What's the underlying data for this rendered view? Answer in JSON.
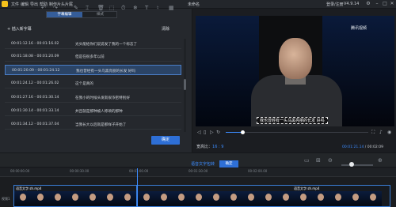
{
  "titlebar": {
    "menus": [
      "文件",
      "编辑",
      "导出",
      "帮助",
      "制作片头片尾"
    ],
    "document_title": "未命名",
    "login": "登录/注册",
    "version": "V4.9.14"
  },
  "subtitle_panel": {
    "tabs": [
      "字幕编辑",
      "样式"
    ],
    "add_button": "+ 插入新字幕",
    "clear_button": "清除",
    "rows": [
      {
        "time": "00:01:12.16 - 00:01:16.02",
        "text": "光头能给你们说说发了我的一个标志了"
      },
      {
        "time": "00:01:18.08 - 00:01:20.09",
        "text": "但是在很多年以前"
      },
      {
        "time": "00:01:20.09 - 00:01:24.12",
        "text": "我也曾经有一头乌黑亮丽的长发 好吗",
        "selected": true
      },
      {
        "time": "00:01:24.12 - 00:01:26.02",
        "text": "这个是真的"
      },
      {
        "time": "00:01:27.16 - 00:01:30.14",
        "text": "在我小的时候头发就很浓密特别好"
      },
      {
        "time": "00:01:30.14 - 00:01:33.14",
        "text": "并且就是那种被人称颂的那种"
      },
      {
        "time": "00:01:34.12 - 00:01:37.04",
        "text": "当我长大以后就是那样子开始了"
      }
    ],
    "confirm": "确定"
  },
  "player": {
    "watermark": "腾讯视频",
    "subtitle_overlay": "我也曾经有一头乌黑亮丽的长发 好吗",
    "ratio_label": "宽高比：",
    "ratio_value": "16 : 9",
    "time_current": "00:01:21.14",
    "time_total": "00:02:09"
  },
  "timeline": {
    "subtitle_track_label": "语音文字包转",
    "confirm": "确定",
    "ticks": [
      "00:00:00.00",
      "00:00:30.00",
      "00:01:00.00",
      "00:01:30.00",
      "00:02:00.00"
    ],
    "clips": [
      {
        "label": "语音文字-zh.mp4"
      },
      {
        "label": "语音文字-zh.mp4"
      }
    ],
    "track_label": "视频1"
  }
}
